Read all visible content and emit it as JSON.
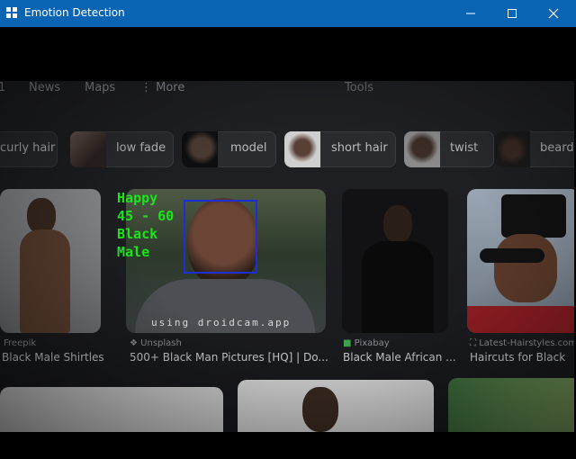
{
  "window": {
    "title": "Emotion Detection",
    "controls": {
      "minimize_icon": "minimize-icon",
      "maximize_icon": "maximize-icon",
      "close_icon": "close-icon"
    },
    "titlebar_color": "#0a64b4"
  },
  "camera_view": {
    "nav_tabs": [
      "News",
      "Maps",
      "⋮ More"
    ],
    "tools_label": "Tools",
    "chips": [
      "curly hair",
      "low fade",
      "model",
      "short hair",
      "twist",
      "beard"
    ],
    "results": [
      {
        "source": "Freepik",
        "caption": "Black Male Shirtles"
      },
      {
        "source": "Unsplash",
        "caption": "500+ Black Man Pictures [HQ] | Do..."
      },
      {
        "source": "Pixabay",
        "caption": "Black Male African ..."
      },
      {
        "source": "Latest-Hairstyles.com",
        "caption": "Haircuts for Black"
      }
    ],
    "watermark": "using droidcam.app"
  },
  "detection": {
    "emotion": "Happy",
    "age": "45 - 60",
    "race": "Black",
    "gender": "Male",
    "label_color": "#19e619",
    "box_color": "#1c2fd6"
  }
}
